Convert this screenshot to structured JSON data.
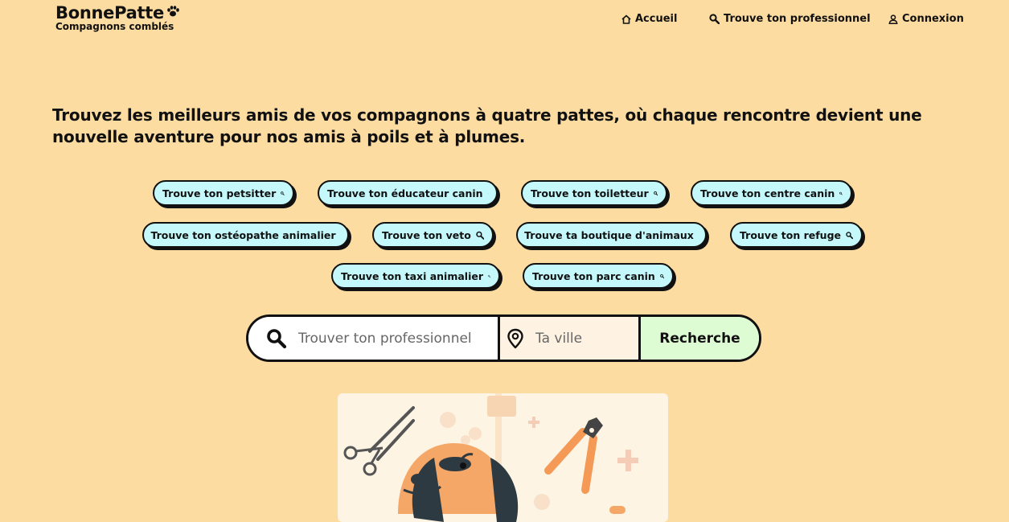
{
  "brand": {
    "name": "BonnePatte",
    "tagline": "Compagnons comblés"
  },
  "nav": {
    "home_label": "Accueil",
    "find_label": "Trouve ton professionnel",
    "login_label": "Connexion"
  },
  "hero": {
    "headline": "Trouvez les meilleurs amis de vos compagnons à quatre pattes, où chaque rencontre devient une nouvelle aventure pour nos amis à poils et à plumes."
  },
  "categories": [
    "Trouve ton petsitter",
    "Trouve ton éducateur canin",
    "Trouve ton toiletteur",
    "Trouve ton centre canin",
    "Trouve ton ostéopathe animalier",
    "Trouve ton veto",
    "Trouve ta boutique d'animaux",
    "Trouve ton refuge",
    "Trouve ton taxi animalier",
    "Trouve ton parc canin"
  ],
  "search": {
    "what_placeholder": "Trouver ton professionnel",
    "where_placeholder": "Ta ville",
    "submit_label": "Recherche"
  },
  "colors": {
    "background": "#fddca1",
    "pill": "#c4f8fb",
    "search_button": "#defcd4",
    "dog": "#f4a766",
    "tools": "#f49a56"
  },
  "icons": [
    "paw-icon",
    "home-icon",
    "search-icon",
    "user-icon",
    "location-pin-icon"
  ]
}
